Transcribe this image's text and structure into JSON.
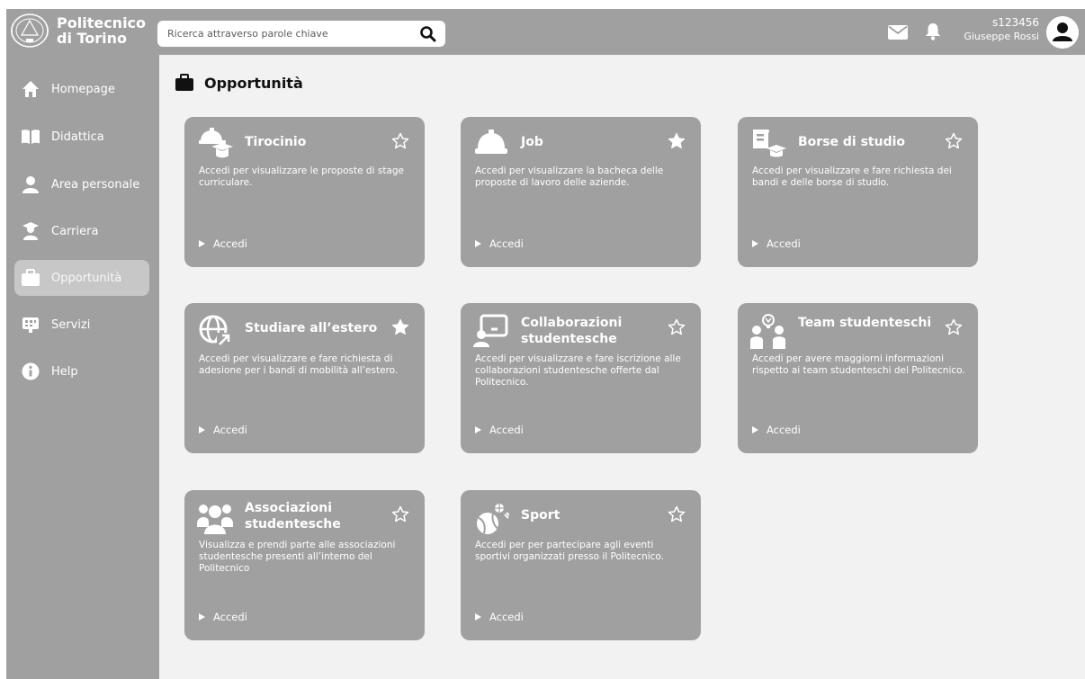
{
  "header": {
    "logo_line1": "Politecnico",
    "logo_line2": "di Torino",
    "search_placeholder": "Ricerca attraverso parole chiave",
    "user_id": "s123456",
    "user_name": "Giuseppe Rossi"
  },
  "sidebar": {
    "items": [
      {
        "label": "Homepage",
        "icon": "home-icon"
      },
      {
        "label": "Didattica",
        "icon": "book-icon"
      },
      {
        "label": "Area personale",
        "icon": "user-icon"
      },
      {
        "label": "Carriera",
        "icon": "graduate-icon"
      },
      {
        "label": "Opportunità",
        "icon": "briefcase-icon",
        "active": true
      },
      {
        "label": "Servizi",
        "icon": "services-icon"
      },
      {
        "label": "Help",
        "icon": "info-icon"
      }
    ]
  },
  "page": {
    "title": "Opportunità"
  },
  "cards": [
    {
      "title": "Tirocinio",
      "desc": "Accedi per visualizzare le proposte di stage curriculare.",
      "action": "Accedi",
      "favorite": false,
      "icon": "internship-icon"
    },
    {
      "title": "Job",
      "desc": "Accedi per visualizzare la bacheca delle proposte di lavoro delle aziende.",
      "action": "Accedi",
      "favorite": true,
      "icon": "hardhat-icon"
    },
    {
      "title": "Borse di studio",
      "desc": "Accedi per visualizzare e fare richiesta dei bandi e delle borse di studio.",
      "action": "Accedi",
      "favorite": false,
      "icon": "scholarship-icon"
    },
    {
      "title": "Studiare all’estero",
      "desc": "Accedi per visualizzare e fare richiesta di adesione per i bandi di mobilità all’estero.",
      "action": "Accedi",
      "favorite": true,
      "icon": "globe-icon"
    },
    {
      "title": "Collaborazioni studentesche",
      "desc": "Accedi per visualizzare e fare iscrizione alle collaborazioni studentesche offerte dal Politecnico.",
      "action": "Accedi",
      "favorite": false,
      "icon": "presenter-icon"
    },
    {
      "title": "Team studenteschi",
      "desc": "Accedi per avere maggiorni informazioni rispetto ai team studenteschi del Politecnico.",
      "action": "Accedi",
      "favorite": false,
      "icon": "team-icon"
    },
    {
      "title": "Associazioni studentesche",
      "desc": "Visualizza e prendi parte alle associazioni studentesche presenti all’interno del Politecnico",
      "action": "Accedi",
      "favorite": false,
      "icon": "group-icon"
    },
    {
      "title": "Sport",
      "desc": "Accedi per per partecipare agli eventi sportivi organizzati presso il Politecnico.",
      "action": "Accedi",
      "favorite": false,
      "icon": "sport-icon"
    }
  ],
  "colors": {
    "panel": "#a0a0a0",
    "background": "#f2f2f2",
    "active_nav": "#c7c7c7",
    "text_on_panel": "#ffffff"
  }
}
